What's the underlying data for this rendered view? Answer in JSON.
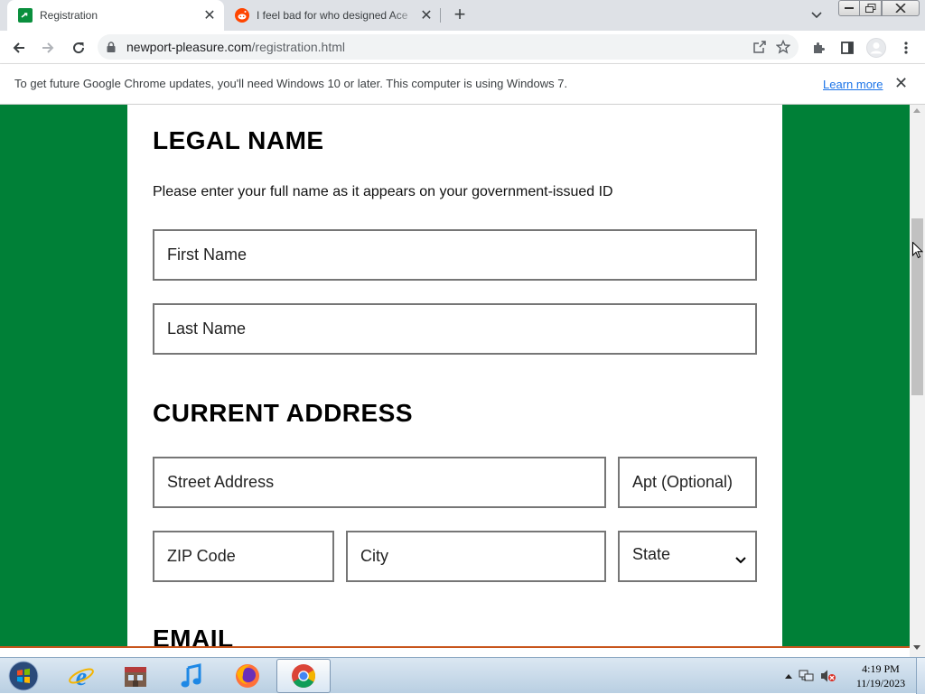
{
  "browser": {
    "tabs": [
      {
        "title": "Registration",
        "active": true,
        "favicon": "green-site-icon"
      },
      {
        "title": "I feel bad for who designed Ace",
        "active": false,
        "favicon": "reddit-icon"
      }
    ],
    "url": {
      "domain": "newport-pleasure.com",
      "path": "/registration.html"
    }
  },
  "infobar": {
    "message": "To get future Google Chrome updates, you'll need Windows 10 or later. This computer is using Windows 7.",
    "link": "Learn more"
  },
  "form": {
    "legal_name": {
      "heading": "LEGAL NAME",
      "description": "Please enter your full name as it appears on your government-issued ID",
      "first_name_placeholder": "First Name",
      "last_name_placeholder": "Last Name"
    },
    "current_address": {
      "heading": "CURRENT ADDRESS",
      "street_placeholder": "Street Address",
      "apt_placeholder": "Apt (Optional)",
      "zip_placeholder": "ZIP Code",
      "city_placeholder": "City",
      "state_selected": "State"
    },
    "email": {
      "heading": "EMAIL"
    }
  },
  "colors": {
    "page_background": "#008037",
    "panel": "#ffffff",
    "field_border": "#767676"
  },
  "taskbar": {
    "apps": [
      "internet-explorer-icon",
      "store-icon",
      "itunes-icon",
      "firefox-icon",
      "chrome-icon"
    ],
    "clock": {
      "time": "4:19 PM",
      "date": "11/19/2023"
    }
  }
}
